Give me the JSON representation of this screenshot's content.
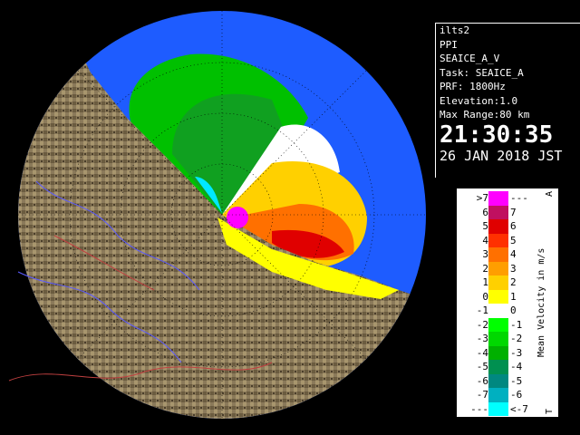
{
  "info": {
    "station": "ilts2",
    "product": "PPI",
    "field": "SEAICE_A_V",
    "task": "Task: SEAICE_A",
    "prf": "PRF: 1800Hz",
    "elevation": "Elevation:1.0",
    "max_range": "Max Range:80 km",
    "time": "21:30:35",
    "date": "26 JAN 2018 JST"
  },
  "legend": {
    "title": "Mean Velocity in m/s",
    "corner_top": "A",
    "corner_bottom": "T",
    "rows": [
      {
        "left": ">7",
        "right": "---",
        "color": "#ff00ff"
      },
      {
        "left": "6",
        "right": "7",
        "color": "#c01060"
      },
      {
        "left": "5",
        "right": "6",
        "color": "#e00000"
      },
      {
        "left": "4",
        "right": "5",
        "color": "#ff3000"
      },
      {
        "left": "3",
        "right": "4",
        "color": "#ff7000"
      },
      {
        "left": "2",
        "right": "3",
        "color": "#ff9e00"
      },
      {
        "left": "1",
        "right": "2",
        "color": "#ffd000"
      },
      {
        "left": "0",
        "right": "1",
        "color": "#ffff00"
      },
      {
        "left": "-1",
        "right": "0",
        "color": "#ffffff"
      },
      {
        "left": "-2",
        "right": "-1",
        "color": "#00ff00"
      },
      {
        "left": "-3",
        "right": "-2",
        "color": "#00d800"
      },
      {
        "left": "-4",
        "right": "-3",
        "color": "#00b000"
      },
      {
        "left": "-5",
        "right": "-4",
        "color": "#009050"
      },
      {
        "left": "-6",
        "right": "-5",
        "color": "#008880"
      },
      {
        "left": "-7",
        "right": "-6",
        "color": "#00b0c0"
      },
      {
        "left": "---",
        "right": "<-7",
        "color": "#00ffff"
      }
    ]
  }
}
